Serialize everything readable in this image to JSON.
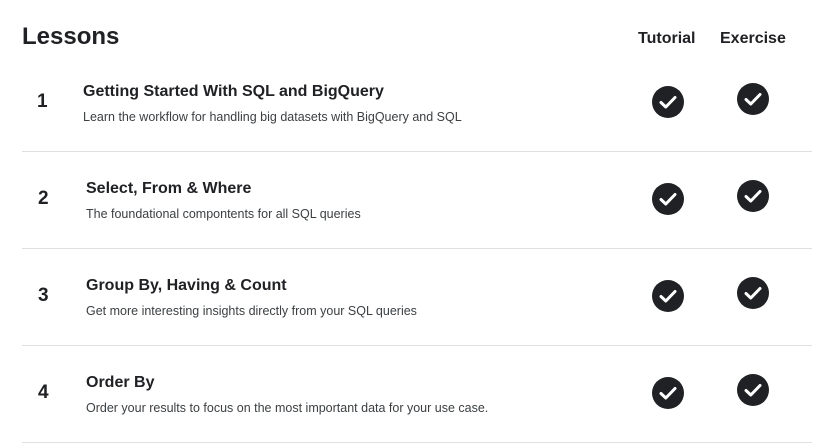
{
  "header": {
    "title": "Lessons",
    "col_tutorial": "Tutorial",
    "col_exercise": "Exercise"
  },
  "lessons": [
    {
      "number": "1",
      "title": "Getting Started With SQL and BigQuery",
      "description": "Learn the workflow for handling big datasets with BigQuery and SQL",
      "tutorial_icon": "check-circle-icon",
      "exercise_icon": "check-circle-icon"
    },
    {
      "number": "2",
      "title": "Select, From & Where",
      "description": "The foundational compontents for all SQL queries",
      "tutorial_icon": "check-circle-icon",
      "exercise_icon": "check-circle-icon"
    },
    {
      "number": "3",
      "title": "Group By, Having & Count",
      "description": "Get more interesting insights directly from your SQL queries",
      "tutorial_icon": "check-circle-icon",
      "exercise_icon": "check-circle-icon"
    },
    {
      "number": "4",
      "title": "Order By",
      "description": "Order your results to focus on the most important data for your use case.",
      "tutorial_icon": "check-circle-icon",
      "exercise_icon": "check-circle-icon"
    }
  ],
  "colors": {
    "text": "#202124",
    "muted": "#3c4043",
    "divider": "#e0e0e0",
    "check_bg": "#202124"
  }
}
